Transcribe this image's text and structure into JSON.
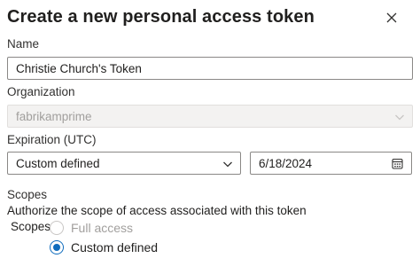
{
  "dialog": {
    "title": "Create a new personal access token",
    "close_icon": "close-icon"
  },
  "name": {
    "label": "Name",
    "value": "Christie Church's Token"
  },
  "organization": {
    "label": "Organization",
    "value": "fabrikamprime",
    "disabled": true
  },
  "expiration": {
    "label": "Expiration (UTC)",
    "selected": "Custom defined",
    "date": "6/18/2024"
  },
  "scopes": {
    "heading": "Scopes",
    "description": "Authorize the scope of access associated with this token",
    "group_label": "Scopes",
    "options": [
      {
        "label": "Full access",
        "checked": false,
        "disabled": true
      },
      {
        "label": "Custom defined",
        "checked": true,
        "disabled": false
      }
    ]
  },
  "colors": {
    "accent": "#0f6cbd",
    "disabled_text": "#a19f9d"
  }
}
